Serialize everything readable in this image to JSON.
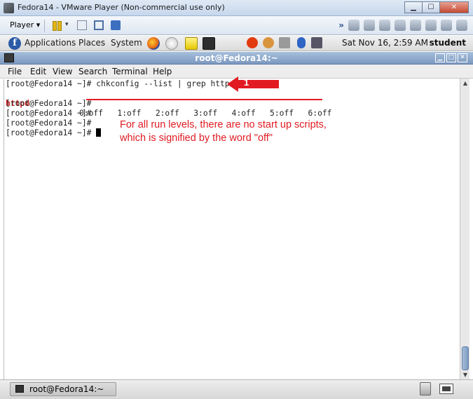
{
  "vm_window": {
    "title": "Fedora14 - VMware Player (Non-commercial use only)",
    "controls": {
      "minimize": "▁",
      "maximize": "☐",
      "close": "✕"
    },
    "toolbar": {
      "player_label": "Player ▾",
      "dropdown_glyph": "▾",
      "overflow_glyph": "»",
      "icons": [
        "pause-icon",
        "network-icon",
        "fullscreen-icon",
        "unity-icon",
        "removable-device-icons"
      ]
    }
  },
  "gnome_panel": {
    "menus": {
      "applications": "Applications",
      "places": "Places",
      "system": "System"
    },
    "clock": "Sat Nov 16,  2:59 AM",
    "user": "student",
    "launchers": [
      "firefox-icon",
      "mail-icon",
      "notes-icon",
      "terminal-icon"
    ],
    "tray_icons": [
      "updates-icon",
      "eye-icon",
      "volume-icon",
      "bluetooth-icon",
      "network-icon"
    ]
  },
  "terminal_window": {
    "title": "root@Fedora14:~",
    "menu": [
      "File",
      "Edit",
      "View",
      "Search",
      "Terminal",
      "Help"
    ],
    "lines": [
      "[root@Fedora14 ~]# chkconfig --list | grep httpd",
      "[root@Fedora14 ~]#",
      "[root@Fedora14 ~]#",
      "[root@Fedora14 ~]#",
      "[root@Fedora14 ~]# "
    ],
    "service_row": {
      "name": "httpd",
      "levels": "0:off   1:off   2:off   3:off   4:off   5:off   6:off"
    }
  },
  "annotation": {
    "step_number": "1",
    "line1": "For all run levels, there are no start up scripts,",
    "line2": "which is signified by the word \"off\"",
    "color": "#e01b22"
  },
  "taskbar": {
    "task_label": "root@Fedora14:~"
  }
}
